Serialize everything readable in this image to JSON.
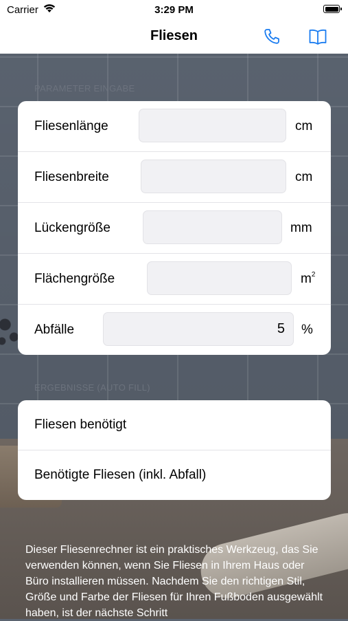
{
  "status_bar": {
    "carrier": "Carrier",
    "time": "3:29 PM"
  },
  "nav": {
    "title": "Fliesen",
    "phone_icon": "phone-icon",
    "book_icon": "book-icon",
    "accent_color": "#1a7cf0"
  },
  "parameters": {
    "header": "Parameter Eingabe",
    "rows": [
      {
        "label": "Fliesenlänge",
        "value": "",
        "unit": "cm"
      },
      {
        "label": "Fliesenbreite",
        "value": "",
        "unit": "cm"
      },
      {
        "label": "Lückengröße",
        "value": "",
        "unit": "mm"
      },
      {
        "label": "Flächengröße",
        "value": "",
        "unit": "m",
        "unit_sup": "2"
      },
      {
        "label": "Abfälle",
        "value": "5",
        "unit": "%"
      }
    ]
  },
  "results": {
    "header": "Ergebnisse (Auto Fill)",
    "rows": [
      {
        "label": "Fliesen benötigt"
      },
      {
        "label": "Benötigte Fliesen (inkl. Abfall)"
      }
    ]
  },
  "description": "Dieser Fliesenrechner ist ein praktisches Werkzeug, das Sie verwenden können, wenn Sie Fliesen in Ihrem Haus oder Büro installieren müssen. Nachdem Sie den richtigen Stil, Größe und Farbe der Fliesen für Ihren Fußboden ausgewählt haben, ist der nächste Schritt"
}
